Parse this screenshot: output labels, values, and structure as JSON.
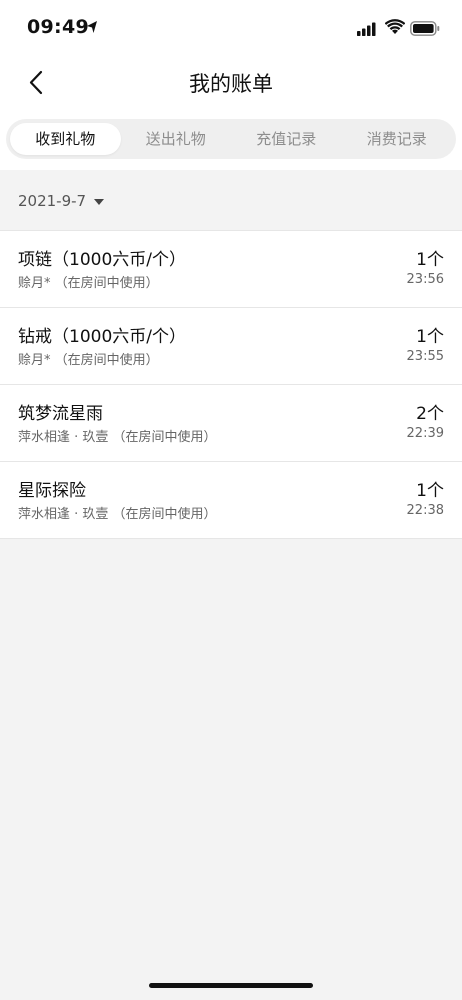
{
  "status_bar": {
    "time": "09:49"
  },
  "nav": {
    "title": "我的账单"
  },
  "tabs": [
    {
      "label": "收到礼物",
      "active": true
    },
    {
      "label": "送出礼物",
      "active": false
    },
    {
      "label": "充值记录",
      "active": false
    },
    {
      "label": "消费记录",
      "active": false
    }
  ],
  "filter": {
    "date": "2021-9-7"
  },
  "records": [
    {
      "title": "项链（1000六币/个）",
      "sub": "赊月*  （在房间中使用）",
      "count": "1个",
      "time": "23:56"
    },
    {
      "title": "钻戒（1000六币/个）",
      "sub": "赊月*  （在房间中使用）",
      "count": "1个",
      "time": "23:55"
    },
    {
      "title": "筑梦流星雨",
      "sub": "萍水相逢 · 玖壹  （在房间中使用）",
      "count": "2个",
      "time": "22:39"
    },
    {
      "title": "星际探险",
      "sub": "萍水相逢 · 玖壹  （在房间中使用）",
      "count": "1个",
      "time": "22:38"
    }
  ],
  "icons": {
    "back": "chevron-left-icon",
    "location": "location-arrow-icon",
    "signal": "cellular-signal-icon",
    "wifi": "wifi-icon",
    "battery": "battery-icon",
    "caret": "caret-down-icon"
  }
}
